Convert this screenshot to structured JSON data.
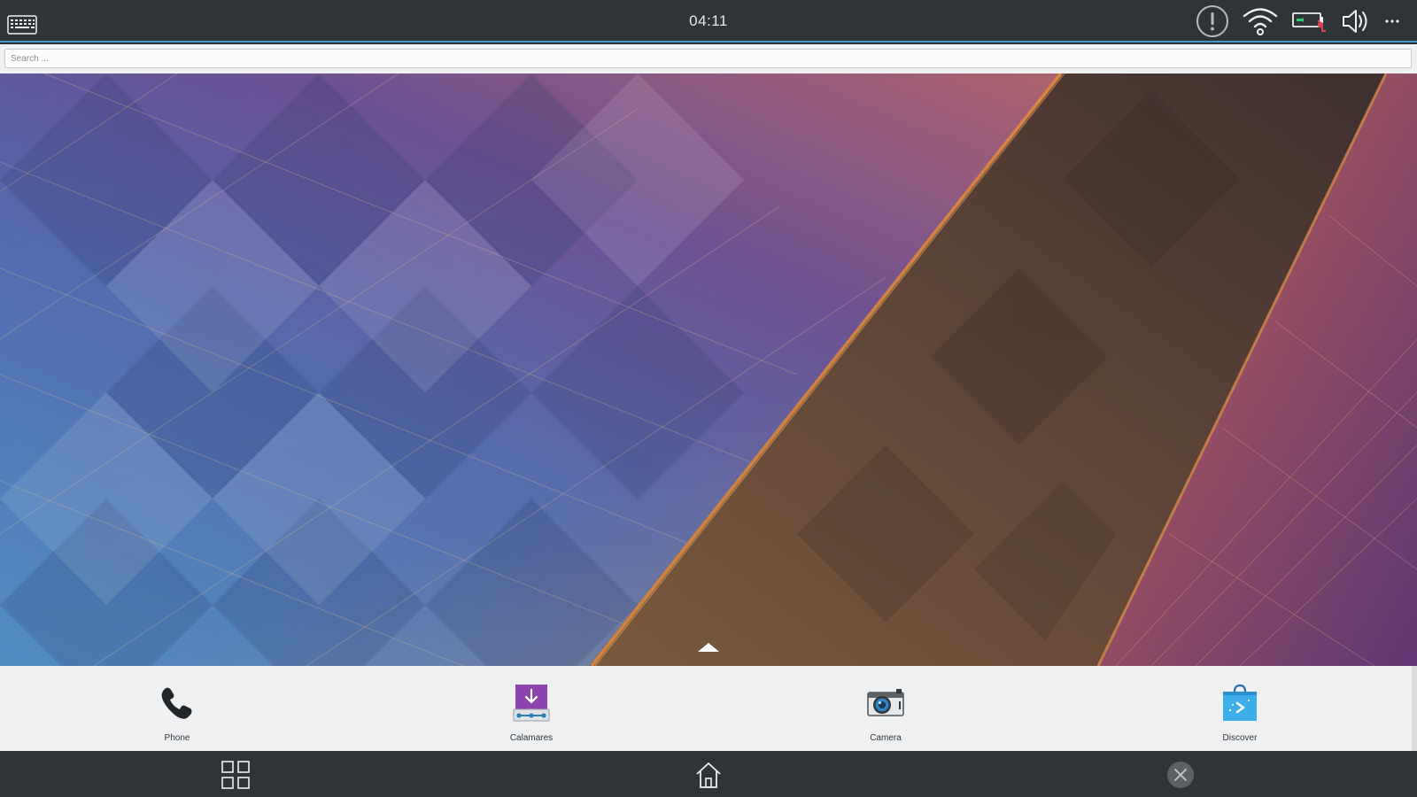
{
  "status_bar": {
    "clock": "04:11",
    "tray_icons": [
      "keyboard-icon",
      "notification-alert-icon",
      "wifi-icon",
      "battery-icon",
      "volume-icon",
      "more-icon"
    ]
  },
  "search": {
    "placeholder": "Search ...",
    "value": ""
  },
  "favorites": [
    {
      "label": "Phone",
      "icon": "phone-icon"
    },
    {
      "label": "Calamares",
      "icon": "calamares-icon"
    },
    {
      "label": "Camera",
      "icon": "camera-icon"
    },
    {
      "label": "Discover",
      "icon": "discover-icon"
    }
  ],
  "navigation": {
    "buttons": [
      "app-grid-icon",
      "home-icon",
      "close-icon"
    ]
  },
  "colors": {
    "panel": "#2f3438",
    "accent": "#3daee9",
    "dock": "#eff0f1",
    "battery_alert": "#da4453"
  }
}
